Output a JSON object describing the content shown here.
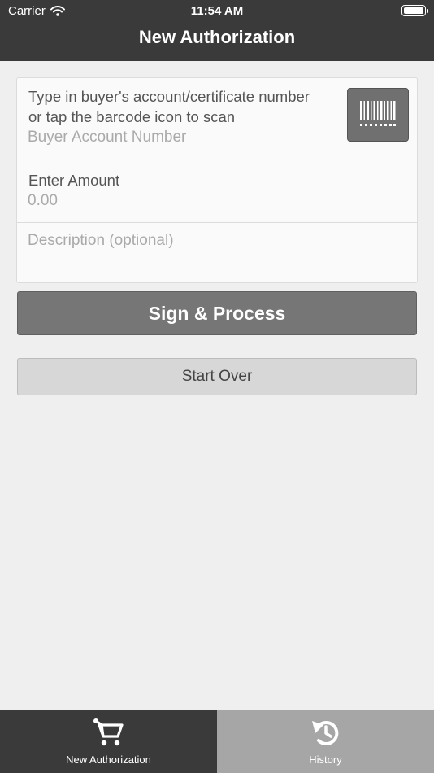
{
  "status_bar": {
    "carrier": "Carrier",
    "time": "11:54 AM"
  },
  "nav": {
    "title": "New Authorization"
  },
  "form": {
    "account_prompt": [
      "Type in buyer's account/certificate number",
      "or tap the barcode icon to scan"
    ],
    "account_placeholder": "Buyer Account Number",
    "amount_label": "Enter Amount",
    "amount_placeholder": "0.00",
    "description_placeholder": "Description (optional)",
    "barcode_icon": "barcode-icon"
  },
  "buttons": {
    "sign_process": "Sign & Process",
    "start_over": "Start Over"
  },
  "tabbar": {
    "items": [
      {
        "label": "New Authorization",
        "icon": "cart-icon",
        "active": true
      },
      {
        "label": "History",
        "icon": "history-icon",
        "active": false
      }
    ]
  },
  "colors": {
    "nav_background": "#3a3a3a",
    "primary_button": "#767676",
    "secondary_button": "#d7d7d7",
    "inactive_tab": "#a6a6a6"
  }
}
